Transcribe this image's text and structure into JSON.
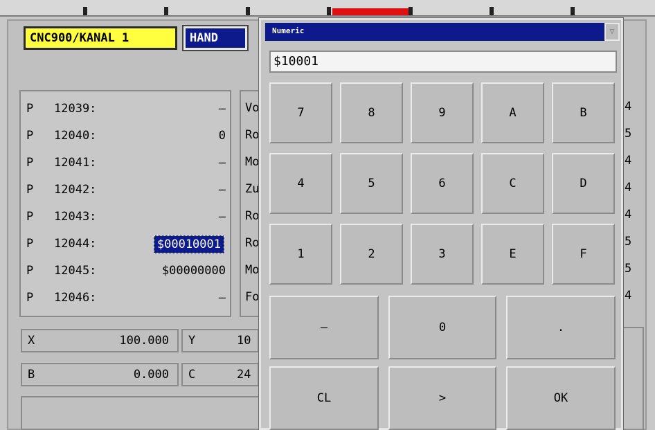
{
  "header": {
    "channel": "CNC900/KANAL 1",
    "mode": "HAND"
  },
  "params": [
    {
      "prefix": "P",
      "number": "12039:",
      "value": "–"
    },
    {
      "prefix": "P",
      "number": "12040:",
      "value": "0"
    },
    {
      "prefix": "P",
      "number": "12041:",
      "value": "–"
    },
    {
      "prefix": "P",
      "number": "12042:",
      "value": "–"
    },
    {
      "prefix": "P",
      "number": "12043:",
      "value": "–"
    },
    {
      "prefix": "P",
      "number": "12044:",
      "value": "$00010001"
    },
    {
      "prefix": "P",
      "number": "12045:",
      "value": "$00000000"
    },
    {
      "prefix": "P",
      "number": "12046:",
      "value": "–"
    }
  ],
  "mid_column_fragments": [
    "Vo",
    "Ro",
    "Mo",
    "Zu",
    "Ro",
    "Ro",
    "Mo",
    "Fo"
  ],
  "right_column_fragments": [
    "4",
    "5",
    "4",
    "4",
    "4",
    "5",
    "5",
    "4"
  ],
  "axes": [
    {
      "label": "X",
      "value": "100.000"
    },
    {
      "label": "Y",
      "value": "10"
    },
    {
      "label": "B",
      "value": "0.000"
    },
    {
      "label": "C",
      "value": "24"
    }
  ],
  "dialog": {
    "title": "Numeric",
    "close_glyph": "▽",
    "input_value": "$10001",
    "keys_row1": [
      "7",
      "8",
      "9",
      "A",
      "B"
    ],
    "keys_row2": [
      "4",
      "5",
      "6",
      "C",
      "D"
    ],
    "keys_row3": [
      "1",
      "2",
      "3",
      "E",
      "F"
    ],
    "keys_row4": [
      "–",
      "0",
      "."
    ],
    "keys_row5": [
      "CL",
      ">",
      "OK"
    ]
  }
}
